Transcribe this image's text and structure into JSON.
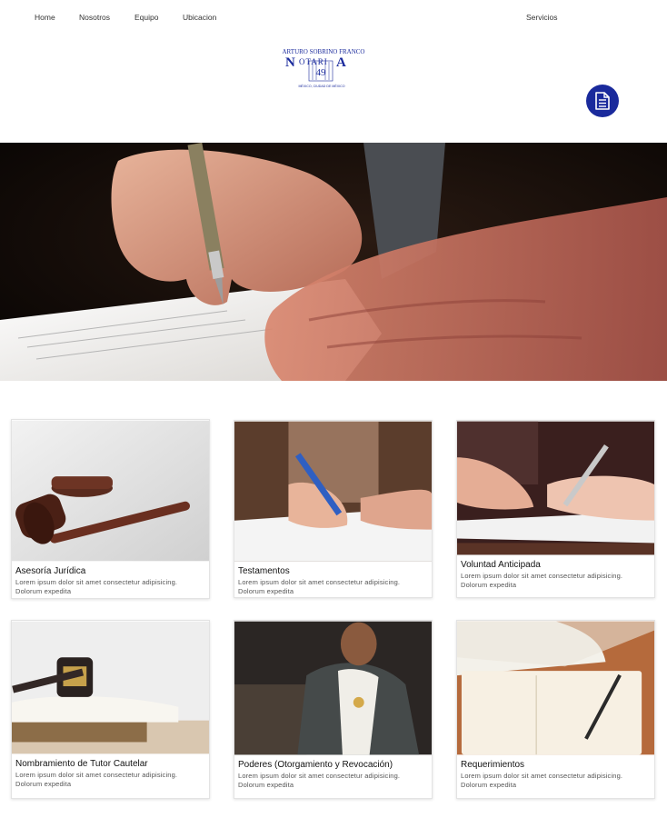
{
  "nav": {
    "home": "Home",
    "nosotros": "Nosotros",
    "equipo": "Equipo",
    "ubicacion": "Ubicacion",
    "servicios": "Servicios"
  },
  "logo": {
    "name": "ARTURO SOBRINO FRANCO",
    "word_left": "N",
    "word_mid": "OTARI",
    "word_right": "A",
    "number": "49",
    "location": "MÉXICO, CIUDAD DE MÉXICO",
    "color": "#1a2a9c"
  },
  "doc_button": {
    "icon": "document-icon",
    "color": "#1a2a9c"
  },
  "services": [
    {
      "title": "Asesoría Jurídica",
      "text": "Lorem ipsum dolor sit amet consectetur adipisicing. Dolorum expedita"
    },
    {
      "title": "Testamentos",
      "text": "Lorem ipsum dolor sit amet consectetur adipisicing. Dolorum expedita"
    },
    {
      "title": "Voluntad Anticipada",
      "text": "Lorem ipsum dolor sit amet consectetur adipisicing. Dolorum expedita"
    },
    {
      "title": "Nombramiento de Tutor Cautelar",
      "text": "Lorem ipsum dolor sit amet consectetur adipisicing. Dolorum expedita"
    },
    {
      "title": "Poderes (Otorgamiento y Revocación)",
      "text": "Lorem ipsum dolor sit amet consectetur adipisicing. Dolorum expedita"
    },
    {
      "title": "Requerimientos",
      "text": "Lorem ipsum dolor sit amet consectetur adipisicing. Dolorum expedita"
    }
  ]
}
